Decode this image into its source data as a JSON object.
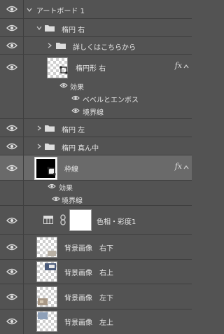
{
  "layers": {
    "artboard": "アートボード 1",
    "ellipse_right_group": "楕円 右",
    "details_group": "詳しくはこちらから",
    "ellipse_shape": "楕円形 右",
    "effects_1": "効果",
    "bevel_emboss": "ベベルとエンボス",
    "stroke_1": "境界線",
    "ellipse_left_group": "楕円 左",
    "ellipse_center_group": "楕円 真ん中",
    "frame": "枠線",
    "effects_2": "効果",
    "stroke_2": "境界線",
    "hue_sat": "色相・彩度1",
    "bg_br": "背景画像　右下",
    "bg_tr": "背景画像　右上",
    "bg_bl": "背景画像　左下",
    "bg_tl": "背景画像　左上"
  },
  "fx_label": "fx",
  "colors": {
    "panel": "#535353",
    "selected": "#6a6a6a",
    "divider": "#3f3f3f"
  }
}
